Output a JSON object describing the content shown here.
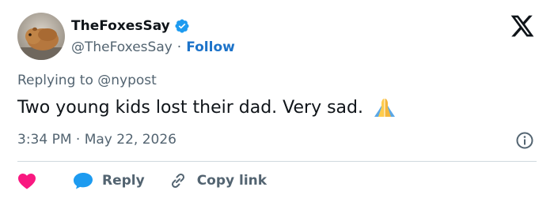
{
  "author": {
    "display_name": "TheFoxesSay",
    "handle": "@TheFoxesSay",
    "separator": "·",
    "follow_label": "Follow",
    "verified": true,
    "avatar_icon": "guinea-pig-avatar"
  },
  "reply_to": "Replying to @nypost",
  "text": "Two young kids lost their dad. Very sad.",
  "emoji": "folded-hands",
  "timestamp": "3:34 PM · May 22, 2026",
  "actions": {
    "like_icon": "heart-icon",
    "reply_label": "Reply",
    "copy_label": "Copy link"
  },
  "colors": {
    "follow": "#1d73c9",
    "verified": "#1d9bf0",
    "heart": "#f91880",
    "reply_icon": "#1d9bf0",
    "secondary_text": "#536471"
  }
}
